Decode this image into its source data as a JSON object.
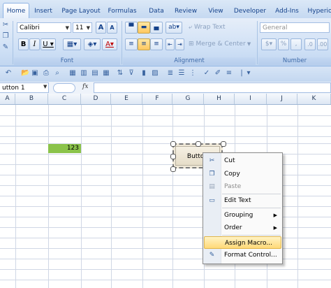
{
  "tabs": [
    {
      "label": "Home",
      "active": true
    },
    {
      "label": "Insert"
    },
    {
      "label": "Page Layout"
    },
    {
      "label": "Formulas"
    },
    {
      "label": "Data"
    },
    {
      "label": "Review"
    },
    {
      "label": "View"
    },
    {
      "label": "Developer"
    },
    {
      "label": "Add-Ins"
    },
    {
      "label": "Hyperio"
    }
  ],
  "font": {
    "name": "Calibri",
    "size": "11",
    "group_label": "Font"
  },
  "alignment": {
    "wrap_text": "Wrap Text",
    "merge_center": "Merge & Center",
    "group_label": "Alignment"
  },
  "number": {
    "format": "General",
    "group_label": "Number"
  },
  "formula_bar": {
    "name_box": "utton 1",
    "fx": "fx"
  },
  "columns": [
    "A",
    "B",
    "C",
    "D",
    "E",
    "F",
    "G",
    "H",
    "I",
    "J",
    "K"
  ],
  "cells": {
    "c_value": "123",
    "c_fill": "#8bc34a"
  },
  "form_button": {
    "label": "Button"
  },
  "context_menu": {
    "cut": "Cut",
    "copy": "Copy",
    "paste": "Paste",
    "edit_text": "Edit Text",
    "grouping": "Grouping",
    "order": "Order",
    "assign_macro": "Assign Macro...",
    "format_control": "Format Control..."
  },
  "colors": {
    "highlight": "#ffd978",
    "ribbon": "#cddff5"
  }
}
